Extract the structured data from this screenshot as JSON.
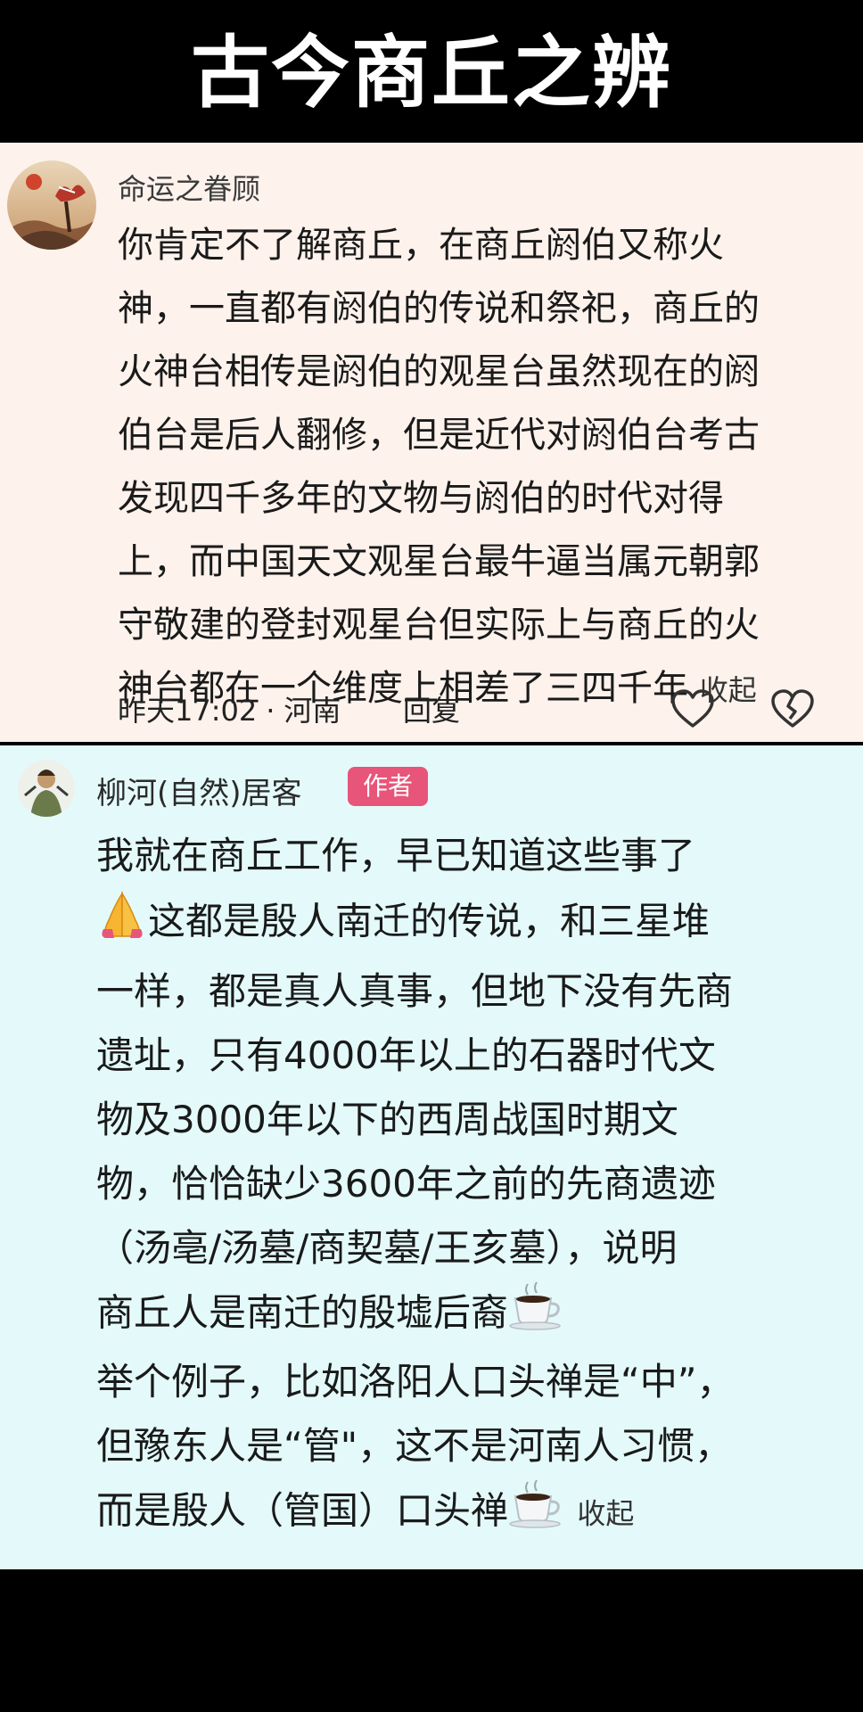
{
  "header": {
    "title": "古今商丘之辨"
  },
  "comment1": {
    "username": "命运之眷顾",
    "lines": [
      "你肯定不了解商丘，在商丘阏伯又称火",
      "神，一直都有阏伯的传说和祭祀，商丘的",
      "火神台相传是阏伯的观星台虽然现在的阏",
      "伯台是后人翻修，但是近代对阏伯台考古",
      "发现四千多年的文物与阏伯的时代对得",
      "上，而中国天文观星台最牛逼当属元朝郭",
      "守敬建的登封观星台但实际上与商丘的火",
      "神台都在一个维度上相差了三四千年"
    ],
    "collapse_label": "收起",
    "time": "昨天17:02",
    "separator": "·",
    "location": "河南",
    "reply_label": "回复"
  },
  "comment2": {
    "username": "柳河(自然)居客",
    "author_badge": "作者",
    "lines": [
      "我就在商丘工作，早已知道这些事了",
      "这都是殷人南迁的传说，和三星堆",
      "一样，都是真人真事，但地下没有先商",
      "遗址，只有4000年以上的石器时代文",
      "物及3000年以下的西周战国时期文",
      "物，恰恰缺少3600年之前的先商遗迹",
      "（汤亳/汤墓/商契墓/王亥墓），说明",
      "商丘人是南迁的殷墟后裔",
      "举个例子，比如洛阳人口头禅是“中”，",
      "但豫东人是“管\"，这不是河南人习惯，",
      "而是殷人（管国）口头禅"
    ],
    "collapse_label": "收起",
    "emojis": [
      "folded-hands",
      "hot-beverage",
      "hot-beverage"
    ]
  },
  "colors": {
    "card1_bg": "#fdf2ec",
    "card2_bg": "#e4fafa",
    "badge_bg": "#e8557a",
    "title_bg": "#000000"
  }
}
